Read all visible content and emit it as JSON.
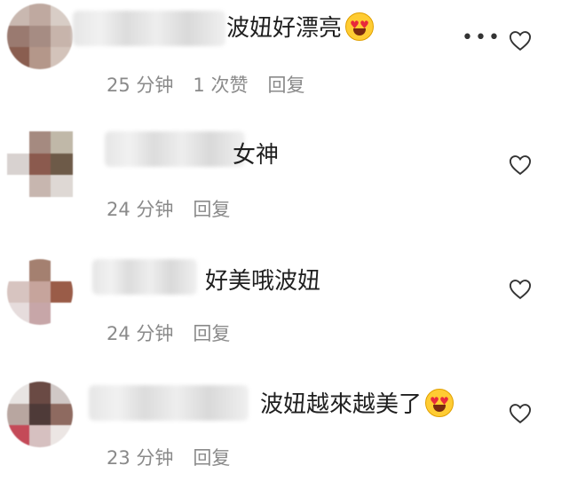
{
  "comments": [
    {
      "text": "波妞好漂亮",
      "has_emoji": true,
      "time": "25 分钟",
      "likes": "1 次赞",
      "reply": "回复",
      "show_more": true
    },
    {
      "text": "女神",
      "has_emoji": false,
      "time": "24 分钟",
      "likes": "",
      "reply": "回复",
      "show_more": false
    },
    {
      "text": "好美哦波妞",
      "has_emoji": false,
      "time": "24 分钟",
      "likes": "",
      "reply": "回复",
      "show_more": false
    },
    {
      "text": "波妞越來越美了",
      "has_emoji": true,
      "time": "23 分钟",
      "likes": "",
      "reply": "回复",
      "show_more": false
    }
  ],
  "icons": {
    "more": "more-options-icon",
    "like": "heart-icon",
    "emoji": "heart-eyes-emoji"
  },
  "colors": {
    "meta_text": "#8a8a8a",
    "comment_text": "#1f1f1f"
  }
}
